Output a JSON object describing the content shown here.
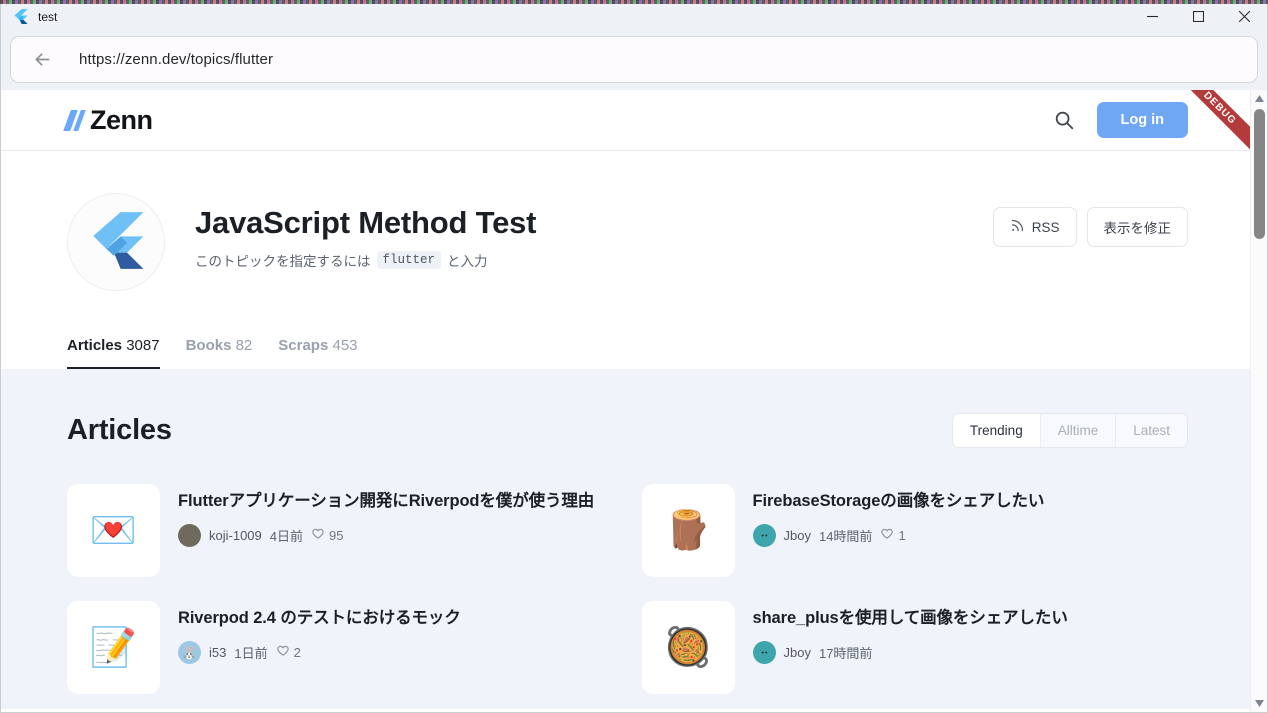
{
  "window": {
    "title": "test",
    "app_icon": "flutter-icon",
    "minimize_label": "—",
    "maximize_label": "□",
    "close_label": "✕"
  },
  "browser": {
    "back_icon": "back-arrow-icon",
    "url": "https://zenn.dev/topics/flutter",
    "debug_banner": "DEBUG"
  },
  "site_header": {
    "logo_text": "Zenn",
    "search_icon": "search-icon",
    "login_label": "Log in",
    "login_color": "#6fa7f5"
  },
  "topic": {
    "avatar_icon": "flutter-logo-icon",
    "title": "JavaScript Method Test",
    "subtitle_prefix": "このトピックを指定するには",
    "subtitle_code": "flutter",
    "subtitle_suffix": "と入力",
    "rss_label": "RSS",
    "rss_icon": "rss-icon",
    "edit_label": "表示を修正"
  },
  "tabs": [
    {
      "label": "Articles",
      "count": "3087",
      "active": true
    },
    {
      "label": "Books",
      "count": "82",
      "active": false
    },
    {
      "label": "Scraps",
      "count": "453",
      "active": false
    }
  ],
  "main": {
    "heading": "Articles",
    "sort_options": [
      {
        "label": "Trending",
        "active": true
      },
      {
        "label": "Alltime",
        "active": false
      },
      {
        "label": "Latest",
        "active": false
      }
    ]
  },
  "articles": [
    {
      "thumb_icon": "love-letter-emoji",
      "thumb_glyph": "💌",
      "title": "Flutterアプリケーション開発にRiverpodを僕が使う理由",
      "author": "koji-1009",
      "avatar_class": "dark",
      "avatar_glyph": "👤",
      "time": "4日前",
      "likes": "95"
    },
    {
      "thumb_icon": "wood-log-emoji",
      "thumb_glyph": "🪵",
      "title": "FirebaseStorageの画像をシェアしたい",
      "author": "Jboy",
      "avatar_class": "cat",
      "avatar_glyph": "🐱",
      "time": "14時間前",
      "likes": "1"
    },
    {
      "thumb_icon": "memo-emoji",
      "thumb_glyph": "📝",
      "title": "Riverpod 2.4 のテストにおけるモック",
      "author": "i53",
      "avatar_class": "bunny",
      "avatar_glyph": "🐰",
      "time": "1日前",
      "likes": "2"
    },
    {
      "thumb_icon": "paella-emoji",
      "thumb_glyph": "🥘",
      "title": "share_plusを使用して画像をシェアしたい",
      "author": "Jboy",
      "avatar_class": "cat",
      "avatar_glyph": "🐱",
      "time": "17時間前",
      "likes": ""
    }
  ],
  "scrollbar": {
    "up_icon": "scroll-up-arrow-icon",
    "down_icon": "scroll-down-arrow-icon"
  }
}
